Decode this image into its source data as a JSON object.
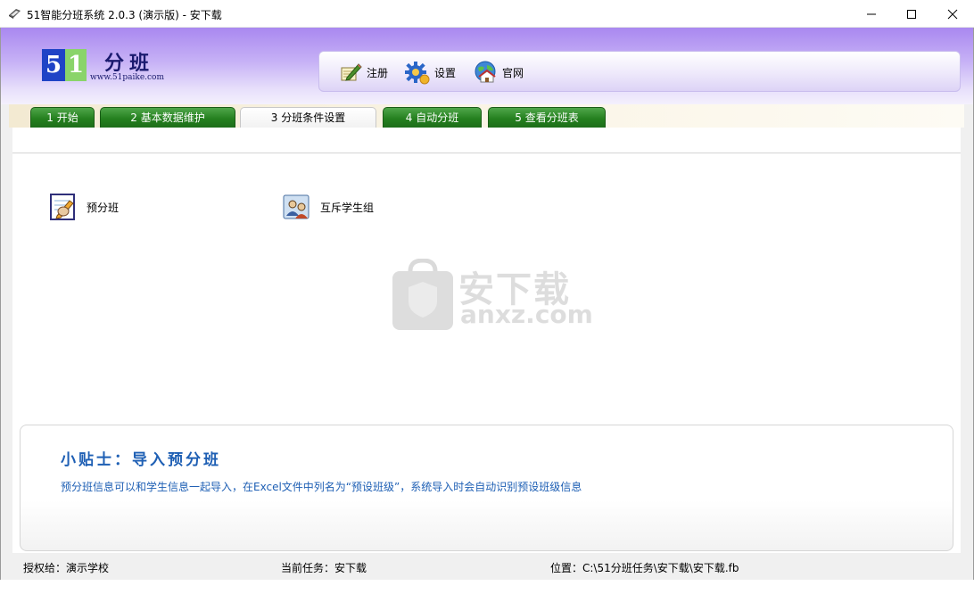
{
  "window": {
    "title": "51智能分班系统 2.0.3 (演示版) - 安下载",
    "icons": {
      "app": "app-book-icon",
      "minimize": "minimize-icon",
      "maximize": "maximize-icon",
      "close": "close-icon"
    }
  },
  "logo": {
    "digit1": "5",
    "digit2": "1",
    "name": "分班",
    "url": "www.51paike.com"
  },
  "toolbar": {
    "items": [
      {
        "label": "注册",
        "icon": "register-pencil-icon"
      },
      {
        "label": "设置",
        "icon": "gear-icon"
      },
      {
        "label": "官网",
        "icon": "globe-home-icon"
      }
    ]
  },
  "tabs": [
    {
      "label": "1 开始"
    },
    {
      "label": "2 基本数据维护"
    },
    {
      "label": "3 分班条件设置",
      "active": true
    },
    {
      "label": "4 自动分班"
    },
    {
      "label": "5 查看分班表"
    }
  ],
  "functions": [
    {
      "label": "预分班",
      "icon": "pre-assign-notepad-icon"
    },
    {
      "label": "互斥学生组",
      "icon": "student-group-icon"
    }
  ],
  "watermark": {
    "text": "安下载",
    "domain": "anxz.com"
  },
  "tips": {
    "title": "小贴士：导入预分班",
    "body": "预分班信息可以和学生信息一起导入，在Excel文件中列名为“预设班级”，系统导入时会自动识别预设班级信息"
  },
  "status": {
    "licensed": "授权给：演示学校",
    "task": "当前任务：安下载",
    "location": "位置：C:\\51分班任务\\安下载\\安下载.fb"
  },
  "colors": {
    "header_top": "#a988f0",
    "tab_green": "#25801f",
    "tips_text": "#1e5fb4",
    "logo_blue": "#1f43c6",
    "logo_green": "#8ad46a"
  }
}
